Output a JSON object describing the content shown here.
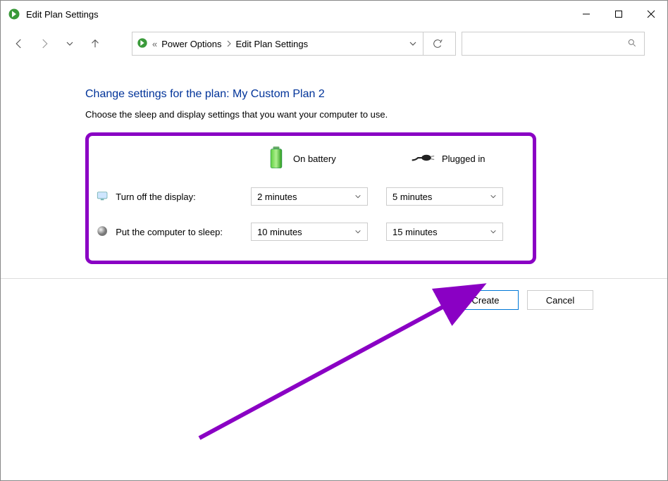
{
  "window": {
    "title": "Edit Plan Settings"
  },
  "breadcrumb": {
    "root": "«",
    "part1": "Power Options",
    "part2": "Edit Plan Settings"
  },
  "page": {
    "title": "Change settings for the plan: My Custom Plan 2",
    "subtitle": "Choose the sleep and display settings that you want your computer to use."
  },
  "columns": {
    "battery": "On battery",
    "plugged": "Plugged in"
  },
  "rows": {
    "display": {
      "label": "Turn off the display:",
      "battery": "2 minutes",
      "plugged": "5 minutes"
    },
    "sleep": {
      "label": "Put the computer to sleep:",
      "battery": "10 minutes",
      "plugged": "15 minutes"
    }
  },
  "buttons": {
    "create": "Create",
    "cancel": "Cancel"
  },
  "annotation": {
    "color": "#8a00c4"
  }
}
